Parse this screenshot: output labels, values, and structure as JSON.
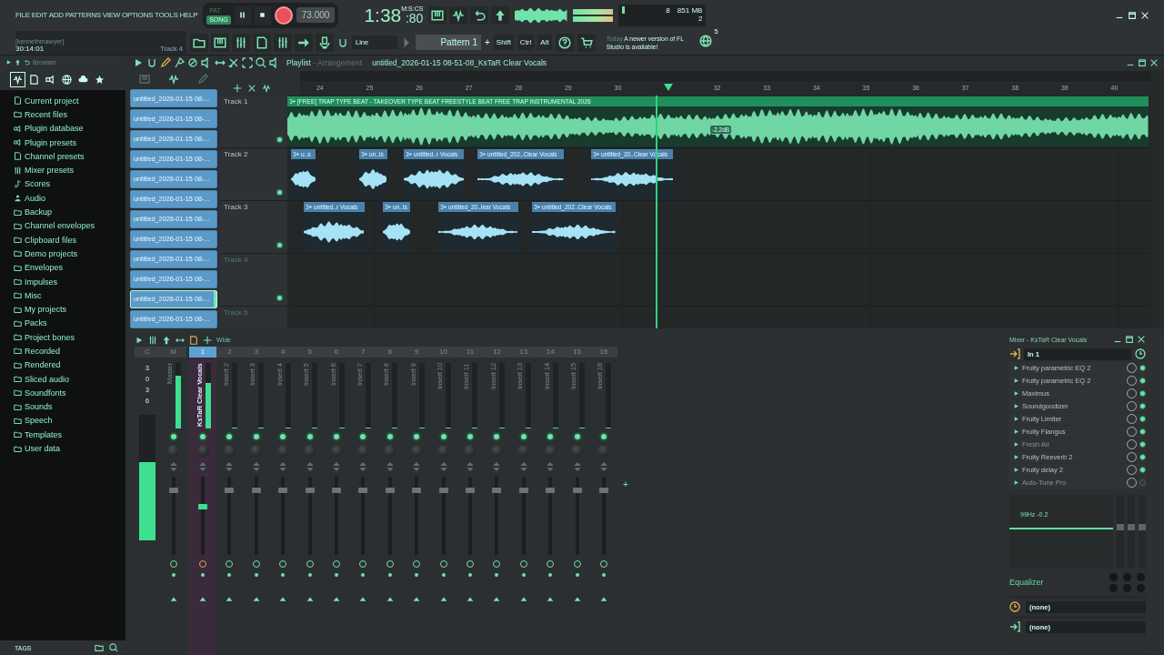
{
  "menu": [
    "FILE",
    "EDIT",
    "ADD",
    "PATTERNS",
    "VIEW",
    "OPTIONS",
    "TOOLS",
    "HELP"
  ],
  "transport": {
    "modes": [
      {
        "label": "PAT",
        "selected": false
      },
      {
        "label": "SONG",
        "selected": true
      }
    ],
    "record_armed": true,
    "tempo": "73.000"
  },
  "clock": {
    "main": "1:38",
    "fraction": ":80",
    "unit": "M:S:CS"
  },
  "system": {
    "value_1": "8",
    "memory": "851 MB",
    "value_2": "2"
  },
  "hint": {
    "user": "[kennethmawyer]",
    "time": "30:14:01",
    "target": "Track 4"
  },
  "snap": "Line",
  "pattern": "Pattern 1",
  "pattern_add": "+",
  "modifiers": [
    "Shift",
    "Ctrl",
    "Alt"
  ],
  "news": {
    "date": "Today",
    "message": "A newer version of FL Studio is available!",
    "count": "5"
  },
  "browser": {
    "title": "Browser",
    "footer": "TAGS",
    "items": [
      "Current project",
      "Recent files",
      "Plugin database",
      "Plugin presets",
      "Channel presets",
      "Mixer presets",
      "Scores",
      "Audio",
      "Backup",
      "Channel envelopes",
      "Clipboard files",
      "Demo projects",
      "Envelopes",
      "Impulses",
      "Misc",
      "My projects",
      "Packs",
      "Project bones",
      "Recorded",
      "Rendered",
      "Sliced audio",
      "Soundfonts",
      "Sounds",
      "Speech",
      "Templates",
      "User data"
    ]
  },
  "playlist": {
    "title": "Playlist",
    "subtitle": "- Arrangement",
    "file": "untitled_2026-01-15 08-51-08_KsTaR Clear Vocals",
    "patterns": [
      {
        "label": "untitled_2026-01-15 08-...",
        "selected": false
      },
      {
        "label": "untitled_2026-01-15 08-...",
        "selected": false
      },
      {
        "label": "untitled_2026-01-15 08-...",
        "selected": false
      },
      {
        "label": "untitled_2026-01-15 08-...",
        "selected": false
      },
      {
        "label": "untitled_2026-01-15 08-...",
        "selected": false
      },
      {
        "label": "untitled_2026-01-15 08-...",
        "selected": false
      },
      {
        "label": "untitled_2026-01-15 08-...",
        "selected": false
      },
      {
        "label": "untitled_2026-01-15 08-...",
        "selected": false
      },
      {
        "label": "untitled_2026-01-15 08-...",
        "selected": false
      },
      {
        "label": "untitled_2026-01-15 08-...",
        "selected": false
      },
      {
        "label": "untitled_2026-01-15 08-...",
        "selected": true
      },
      {
        "label": "untitled_2026-01-15 08-...",
        "selected": false
      }
    ],
    "ruler": [
      "24",
      "25",
      "26",
      "27",
      "28",
      "29",
      "30",
      "32",
      "33",
      "34",
      "35",
      "36",
      "37",
      "38",
      "39",
      "40"
    ],
    "tracks": [
      {
        "name": "Track 1",
        "active": true,
        "clips": [
          {
            "kind": "beat",
            "label": "[FREE] TRAP TYPE BEAT - TAKEOVER  TYPE BEAT  FREESTYLE BEAT  FREE TRAP INSTRUMENTAL 2026",
            "gain": "-2.2dB"
          }
        ]
      },
      {
        "name": "Track 2",
        "active": true,
        "clips": [
          {
            "kind": "vocal",
            "label": "u..s"
          },
          {
            "kind": "vocal",
            "label": "un..ls"
          },
          {
            "kind": "vocal",
            "label": "untitled..r Vocals"
          },
          {
            "kind": "vocal",
            "label": "untitled_202..Clear Vocals"
          },
          {
            "kind": "vocal",
            "label": "untitled_20..Clear Vocals"
          }
        ]
      },
      {
        "name": "Track 3",
        "active": true,
        "clips": [
          {
            "kind": "vocal",
            "label": "untitled..r Vocals"
          },
          {
            "kind": "vocal",
            "label": "un..ls"
          },
          {
            "kind": "vocal",
            "label": "untitled_20..lear Vocals"
          },
          {
            "kind": "vocal",
            "label": "untitled_202..Clear Vocals"
          }
        ]
      },
      {
        "name": "Track 4",
        "active": false
      },
      {
        "name": "Track 5",
        "active": false
      }
    ]
  },
  "mixer": {
    "stereo": "Wide",
    "scale_header": "C",
    "scale": [
      "3",
      "0",
      "3",
      "6"
    ],
    "peak": {
      "level": 0.62
    },
    "add_insert": "+",
    "strips": [
      {
        "number": "M",
        "name": "Master",
        "selected": false,
        "meter": {
          "level": 0.8
        },
        "fader": {
          "level": 0.85
        }
      },
      {
        "number": "1",
        "name": "KsTaR Clear Vocals",
        "selected": true,
        "meter": {
          "level": 0.7
        },
        "fader": {
          "level": 0.62
        }
      },
      {
        "number": "2",
        "name": "Insert 2",
        "selected": false,
        "meter": {
          "level": 0
        },
        "fader": {
          "level": 0.85
        }
      },
      {
        "number": "3",
        "name": "Insert 3",
        "selected": false,
        "meter": {
          "level": 0
        },
        "fader": {
          "level": 0.85
        }
      },
      {
        "number": "4",
        "name": "Insert 4",
        "selected": false,
        "meter": {
          "level": 0
        },
        "fader": {
          "level": 0.85
        }
      },
      {
        "number": "5",
        "name": "Insert 5",
        "selected": false,
        "meter": {
          "level": 0
        },
        "fader": {
          "level": 0.85
        }
      },
      {
        "number": "6",
        "name": "Insert 6",
        "selected": false,
        "meter": {
          "level": 0
        },
        "fader": {
          "level": 0.85
        }
      },
      {
        "number": "7",
        "name": "Insert 7",
        "selected": false,
        "meter": {
          "level": 0
        },
        "fader": {
          "level": 0.85
        }
      },
      {
        "number": "8",
        "name": "Insert 8",
        "selected": false,
        "meter": {
          "level": 0
        },
        "fader": {
          "level": 0.85
        }
      },
      {
        "number": "9",
        "name": "Insert 9",
        "selected": false,
        "meter": {
          "level": 0
        },
        "fader": {
          "level": 0.85
        }
      },
      {
        "number": "10",
        "name": "Insert 10",
        "selected": false,
        "meter": {
          "level": 0
        },
        "fader": {
          "level": 0.85
        }
      },
      {
        "number": "11",
        "name": "Insert 11",
        "selected": false,
        "meter": {
          "level": 0
        },
        "fader": {
          "level": 0.85
        }
      },
      {
        "number": "12",
        "name": "Insert 12",
        "selected": false,
        "meter": {
          "level": 0
        },
        "fader": {
          "level": 0.85
        }
      },
      {
        "number": "13",
        "name": "Insert 13",
        "selected": false,
        "meter": {
          "level": 0
        },
        "fader": {
          "level": 0.85
        }
      },
      {
        "number": "14",
        "name": "Insert 14",
        "selected": false,
        "meter": {
          "level": 0
        },
        "fader": {
          "level": 0.85
        }
      },
      {
        "number": "15",
        "name": "Insert 15",
        "selected": false,
        "meter": {
          "level": 0
        },
        "fader": {
          "level": 0.85
        }
      },
      {
        "number": "16",
        "name": "Insert 16",
        "selected": false,
        "meter": {
          "level": 0
        },
        "fader": {
          "level": 0.85
        }
      }
    ]
  },
  "fx": {
    "title": "Mixer - KsTaR Clear Vocals",
    "input": "In 1",
    "slots": [
      {
        "name": "Fruity parametric EQ 2",
        "active": true,
        "enabled": true
      },
      {
        "name": "Fruity parametric EQ 2",
        "active": true,
        "enabled": true
      },
      {
        "name": "Maximus",
        "active": true,
        "enabled": true
      },
      {
        "name": "Soundgoodizer",
        "active": true,
        "enabled": true
      },
      {
        "name": "Fruity Limiter",
        "active": true,
        "enabled": true
      },
      {
        "name": "Fruity Flangus",
        "active": true,
        "enabled": true
      },
      {
        "name": "Fresh Air",
        "active": false,
        "enabled": true
      },
      {
        "name": "Fruity Reeverb 2",
        "active": true,
        "enabled": true
      },
      {
        "name": "Fruity delay 2",
        "active": true,
        "enabled": true
      },
      {
        "name": "Auto-Tune Pro",
        "active": false,
        "enabled": false
      }
    ],
    "eq_readout": "99Hz -0.2",
    "eq_label": "Equalizer",
    "sends": [
      "(none)",
      "(none)"
    ]
  }
}
